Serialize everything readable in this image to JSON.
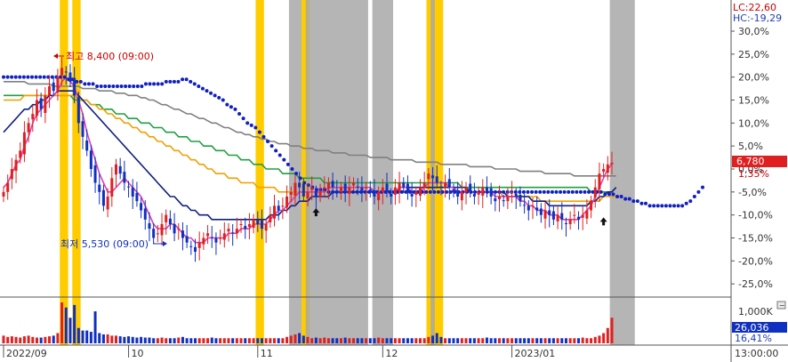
{
  "lc_label": "LC:22,60",
  "hc_label": "HC:-19,29",
  "price_tag": {
    "value": "6,780",
    "pct": "1,35%"
  },
  "high_annotation": "최고 8,400 (09:00)",
  "low_annotation": "최저 5,530 (09:00)",
  "volume_tag": {
    "value": "26,036",
    "pct": "16,41%",
    "max_label": "1,000K"
  },
  "time_label": "13:00:00",
  "x_labels": [
    {
      "label": "2022/09",
      "day": 0
    },
    {
      "label": "10",
      "day": 30
    },
    {
      "label": "11",
      "day": 61
    },
    {
      "label": "12",
      "day": 91
    },
    {
      "label": "2023/01",
      "day": 122
    }
  ],
  "colors": {
    "up": "#e02020",
    "down": "#1030c0",
    "ma5": "#e040b0",
    "ma20": "#102080",
    "ma60": "#f0a000",
    "ma120": "#20a040",
    "ma240": "#808080",
    "dots": "#1020c0",
    "yellow": "#ffcc00",
    "gray": "#a8a8a8"
  },
  "chart_data": {
    "type": "candlestick",
    "ylabel_unit": "%",
    "y_ticks": [
      "30,0%",
      "25,0%",
      "20,0%",
      "15,0%",
      "10,0%",
      "5,0%",
      "0,0%",
      "-5,0%",
      "-10,0%",
      "-15,0%",
      "-20,0%",
      "-25,0%"
    ],
    "y_tick_values": [
      30,
      25,
      20,
      15,
      10,
      5,
      0,
      -5,
      -10,
      -15,
      -20,
      -25
    ],
    "ylim": [
      -30,
      33
    ],
    "current": {
      "pct": 1.35
    },
    "high": {
      "price": 8400,
      "pct": 22.6,
      "day": 14
    },
    "low": {
      "price": 5530,
      "pct": -19.29,
      "day": 46
    },
    "highlight_bands": [
      {
        "type": "yellow",
        "start": 14,
        "end": 15
      },
      {
        "type": "yellow",
        "start": 17,
        "end": 18
      },
      {
        "type": "yellow",
        "start": 61,
        "end": 62
      },
      {
        "type": "gray",
        "start": 69,
        "end": 72
      },
      {
        "type": "yellow",
        "start": 72,
        "end": 73
      },
      {
        "type": "gray",
        "start": 73,
        "end": 87
      },
      {
        "type": "gray",
        "start": 89,
        "end": 93
      },
      {
        "type": "yellow",
        "start": 102,
        "end": 103
      },
      {
        "type": "gray",
        "start": 103,
        "end": 104
      },
      {
        "type": "yellow",
        "start": 104,
        "end": 105
      },
      {
        "type": "gray",
        "start": 146,
        "end": 151
      }
    ],
    "marker_arrows": [
      {
        "day": 75,
        "pct": -9.5
      },
      {
        "day": 144,
        "pct": -11.5
      }
    ],
    "closes": [
      -5,
      -3,
      0,
      2,
      4,
      8,
      10,
      12,
      15,
      13,
      16,
      18,
      17,
      20,
      22,
      21,
      19,
      16,
      10,
      7,
      4,
      0,
      -3,
      -5,
      -8,
      -6,
      -2,
      1,
      -1,
      -3,
      -4,
      -6,
      -7,
      -9,
      -11,
      -13,
      -15,
      -14,
      -12,
      -10,
      -12,
      -14,
      -13,
      -15,
      -16,
      -17,
      -18,
      -16,
      -15,
      -14,
      -15,
      -16,
      -15,
      -14,
      -13,
      -14,
      -13,
      -12,
      -13,
      -12,
      -11,
      -12,
      -13,
      -12,
      -10,
      -8,
      -9,
      -8,
      -6,
      -5,
      -3,
      -4,
      -6,
      -5,
      -4,
      -6,
      -5,
      -4,
      -3,
      -4,
      -5,
      -4,
      -5,
      -4,
      -3,
      -4,
      -5,
      -4,
      -5,
      -6,
      -5,
      -4,
      -5,
      -6,
      -4,
      -3,
      -4,
      -5,
      -6,
      -5,
      -4,
      -3,
      -1,
      -2,
      -3,
      -4,
      -3,
      -4,
      -5,
      -6,
      -5,
      -4,
      -5,
      -6,
      -5,
      -4,
      -5,
      -6,
      -7,
      -6,
      -7,
      -6,
      -5,
      -6,
      -7,
      -8,
      -9,
      -8,
      -9,
      -10,
      -9,
      -10,
      -11,
      -10,
      -11,
      -12,
      -11,
      -10,
      -11,
      -10,
      -9,
      -7,
      -4,
      -1,
      0,
      1,
      1.35
    ],
    "ma5": [
      -4,
      -3,
      -1,
      1,
      2,
      5,
      7,
      10,
      12,
      13,
      14,
      15,
      16,
      17,
      19,
      20,
      19,
      18,
      15,
      12,
      8,
      5,
      2,
      -1,
      -3,
      -5,
      -5,
      -4,
      -3,
      -2,
      -3,
      -4,
      -5,
      -6,
      -8,
      -10,
      -12,
      -13,
      -13,
      -13,
      -12,
      -12,
      -13,
      -14,
      -15,
      -15,
      -16,
      -16,
      -16,
      -15,
      -15,
      -15,
      -15,
      -15,
      -14,
      -14,
      -14,
      -13,
      -13,
      -13,
      -12,
      -12,
      -12,
      -12,
      -11,
      -10,
      -9,
      -9,
      -8,
      -7,
      -6,
      -5,
      -5,
      -5,
      -5,
      -5,
      -5,
      -5,
      -4,
      -4,
      -4,
      -4,
      -4,
      -4,
      -4,
      -4,
      -4,
      -4,
      -4,
      -5,
      -5,
      -5,
      -5,
      -5,
      -5,
      -4,
      -4,
      -4,
      -5,
      -5,
      -5,
      -4,
      -3,
      -3,
      -3,
      -3,
      -3,
      -4,
      -4,
      -5,
      -5,
      -5,
      -5,
      -5,
      -5,
      -5,
      -5,
      -5,
      -6,
      -6,
      -6,
      -6,
      -6,
      -6,
      -7,
      -7,
      -8,
      -8,
      -9,
      -9,
      -9,
      -10,
      -10,
      -10,
      -11,
      -11,
      -11,
      -11,
      -11,
      -10,
      -9,
      -8,
      -6,
      -4,
      -2,
      0,
      1
    ],
    "ma20": [
      8,
      9,
      10,
      11,
      12,
      13,
      13,
      14,
      14,
      15,
      15,
      16,
      16,
      17,
      17,
      17,
      17,
      17,
      16,
      15,
      14,
      13,
      12,
      11,
      10,
      9,
      8,
      7,
      6,
      5,
      4,
      3,
      2,
      1,
      0,
      -1,
      -2,
      -3,
      -4,
      -5,
      -6,
      -6,
      -7,
      -8,
      -8,
      -9,
      -9,
      -10,
      -10,
      -10,
      -11,
      -11,
      -11,
      -11,
      -11,
      -11,
      -11,
      -11,
      -11,
      -11,
      -11,
      -11,
      -11,
      -11,
      -10,
      -10,
      -10,
      -9,
      -9,
      -8,
      -8,
      -7,
      -7,
      -7,
      -6,
      -6,
      -6,
      -6,
      -6,
      -5,
      -5,
      -5,
      -5,
      -5,
      -5,
      -5,
      -5,
      -5,
      -5,
      -5,
      -5,
      -5,
      -5,
      -5,
      -5,
      -4,
      -4,
      -4,
      -4,
      -4,
      -4,
      -4,
      -4,
      -4,
      -4,
      -4,
      -4,
      -4,
      -4,
      -4,
      -4,
      -4,
      -5,
      -5,
      -5,
      -5,
      -5,
      -5,
      -5,
      -5,
      -5,
      -6,
      -6,
      -6,
      -6,
      -6,
      -6,
      -7,
      -7,
      -7,
      -7,
      -8,
      -8,
      -8,
      -8,
      -8,
      -8,
      -8,
      -8,
      -8,
      -8,
      -7,
      -7,
      -6,
      -6,
      -5,
      -5,
      -4
    ],
    "ma60": [
      15,
      15,
      15,
      15,
      15,
      16,
      16,
      16,
      16,
      16,
      16,
      16,
      16,
      16,
      16,
      16,
      16,
      16,
      15,
      15,
      15,
      14,
      14,
      13,
      13,
      12,
      12,
      11,
      11,
      10,
      10,
      9,
      9,
      8,
      8,
      7,
      7,
      6,
      6,
      5,
      5,
      4,
      4,
      3,
      3,
      2,
      2,
      1,
      1,
      0,
      0,
      -1,
      -1,
      -1,
      -2,
      -2,
      -2,
      -3,
      -3,
      -3,
      -3,
      -4,
      -4,
      -4,
      -4,
      -4,
      -5,
      -5,
      -5,
      -5,
      -5,
      -5,
      -5,
      -5,
      -5,
      -5,
      -5,
      -5,
      -5,
      -5,
      -5,
      -5,
      -5,
      -5,
      -5,
      -5,
      -5,
      -5,
      -5,
      -5,
      -5,
      -5,
      -5,
      -5,
      -5,
      -5,
      -5,
      -5,
      -5,
      -5,
      -5,
      -5,
      -5,
      -5,
      -5,
      -5,
      -5,
      -5,
      -5,
      -5,
      -5,
      -5,
      -5,
      -5,
      -5,
      -5,
      -5,
      -5,
      -5,
      -5,
      -6,
      -6,
      -6,
      -6,
      -6,
      -6,
      -6,
      -6,
      -6,
      -7,
      -7,
      -7,
      -7,
      -7,
      -7,
      -7,
      -7,
      -7,
      -7,
      -7,
      -7,
      -7,
      -7,
      -7,
      -6,
      -6,
      -6,
      -6
    ],
    "ma120": [
      16,
      16,
      16,
      16,
      16,
      16,
      16,
      16,
      16,
      16,
      16,
      16,
      16,
      16,
      16,
      16,
      16,
      15,
      15,
      15,
      15,
      14,
      14,
      14,
      13,
      13,
      13,
      12,
      12,
      12,
      11,
      11,
      11,
      10,
      10,
      10,
      9,
      9,
      9,
      8,
      8,
      8,
      7,
      7,
      7,
      6,
      6,
      6,
      5,
      5,
      5,
      4,
      4,
      4,
      3,
      3,
      3,
      2,
      2,
      2,
      1,
      1,
      1,
      0,
      0,
      0,
      0,
      -1,
      -1,
      -1,
      -1,
      -2,
      -2,
      -2,
      -2,
      -2,
      -2,
      -3,
      -3,
      -3,
      -3,
      -3,
      -3,
      -3,
      -3,
      -3,
      -3,
      -3,
      -3,
      -3,
      -3,
      -3,
      -3,
      -3,
      -3,
      -3,
      -3,
      -3,
      -3,
      -3,
      -3,
      -3,
      -3,
      -3,
      -3,
      -3,
      -3,
      -3,
      -3,
      -3,
      -4,
      -4,
      -4,
      -4,
      -4,
      -4,
      -4,
      -4,
      -4,
      -4,
      -4,
      -4,
      -4,
      -4,
      -4,
      -4,
      -4,
      -4,
      -4,
      -4,
      -4,
      -4,
      -4,
      -4,
      -4,
      -4,
      -4,
      -4,
      -4,
      -4,
      -4,
      -5,
      -5,
      -5,
      -5,
      -5
    ],
    "ma240": [
      19,
      19,
      19,
      19,
      19,
      19,
      18.5,
      18.5,
      18.5,
      18.5,
      18.5,
      18.5,
      18,
      18,
      18,
      18,
      18,
      18,
      18,
      17.5,
      17.5,
      17.5,
      17.5,
      17,
      17,
      17,
      17,
      16.5,
      16.5,
      16.5,
      16,
      16,
      16,
      15.5,
      15.5,
      15,
      15,
      14.5,
      14,
      14,
      13.5,
      13,
      13,
      12.5,
      12,
      12,
      11.5,
      11,
      11,
      10.5,
      10,
      10,
      9.5,
      9,
      9,
      8.5,
      8,
      8,
      7.5,
      7.5,
      7,
      7,
      6.5,
      6.5,
      6,
      6,
      5.5,
      5.5,
      5.5,
      5,
      5,
      5,
      4.5,
      4.5,
      4.5,
      4,
      4,
      4,
      4,
      3.5,
      3.5,
      3.5,
      3.5,
      3,
      3,
      3,
      3,
      3,
      2.5,
      2.5,
      2.5,
      2.5,
      2.5,
      2,
      2,
      2,
      2,
      2,
      2,
      1.5,
      1.5,
      1.5,
      1.5,
      1.5,
      1.5,
      1,
      1,
      1,
      1,
      1,
      1,
      1,
      0.5,
      0.5,
      0.5,
      0.5,
      0.5,
      0.5,
      0,
      0,
      0,
      0,
      0,
      0,
      -0.5,
      -0.5,
      -0.5,
      -0.5,
      -0.5,
      -0.5,
      -1,
      -1,
      -1,
      -1,
      -1,
      -1,
      -1,
      -1.5,
      -1.5,
      -1.5,
      -1.5,
      -1.5,
      -1.5,
      -1.5,
      -1.5,
      -1.5,
      -1.5,
      -1.5
    ],
    "dots": [
      20,
      20,
      20,
      20,
      20,
      20,
      20,
      20,
      20,
      20,
      20,
      20,
      20,
      20,
      20,
      20,
      19.5,
      19.5,
      19,
      19,
      18.5,
      18.5,
      18.5,
      18,
      18,
      18,
      18,
      18,
      18,
      18,
      18,
      18,
      18,
      18,
      18,
      18.5,
      18.5,
      18.5,
      18.5,
      18.5,
      19,
      19,
      19,
      19,
      19.5,
      19.5,
      19,
      18.5,
      18,
      17.5,
      17,
      16.5,
      16,
      15.5,
      15,
      14,
      13.5,
      13,
      12,
      11,
      10,
      9.5,
      9,
      8,
      7,
      6,
      5,
      4,
      3,
      2,
      1,
      0,
      -1,
      -2,
      -3,
      -3.5,
      -4,
      -4.5,
      -4.5,
      -4.5,
      -5,
      -5,
      -5,
      -5,
      -5,
      -5,
      -5,
      -5,
      -5,
      -5,
      -5,
      -5,
      -5,
      -5,
      -5,
      -5,
      -5,
      -5,
      -5,
      -5,
      -5,
      -5,
      -5,
      -5,
      -5,
      -5,
      -5,
      -5,
      -5,
      -5,
      -5,
      -5,
      -5,
      -5,
      -5,
      -5,
      -5,
      -5,
      -5,
      -5,
      -5,
      -5,
      -5,
      -5,
      -5,
      -5,
      -5,
      -5,
      -5,
      -5,
      -5,
      -5,
      -5,
      -5,
      -5,
      -5,
      -5,
      -5,
      -5,
      -5,
      -5,
      -5,
      -5,
      -5,
      -5,
      -5,
      -5,
      -5,
      -5.5,
      -5.5,
      -5.5,
      -6,
      -6,
      -6.5,
      -6.5,
      -7,
      -7,
      -7.5,
      -7.5,
      -8,
      -8,
      -8,
      -8,
      -8,
      -8,
      -8,
      -8,
      -8,
      -7.5,
      -7,
      -6,
      -5,
      -4
    ],
    "volumes": [
      60,
      50,
      55,
      50,
      45,
      55,
      60,
      50,
      45,
      45,
      50,
      55,
      60,
      80,
      320,
      280,
      200,
      300,
      120,
      100,
      100,
      90,
      250,
      80,
      70,
      70,
      60,
      60,
      55,
      50,
      55,
      50,
      45,
      50,
      45,
      45,
      40,
      40,
      45,
      40,
      40,
      40,
      45,
      50,
      40,
      40,
      40,
      40,
      40,
      40,
      45,
      40,
      40,
      40,
      40,
      40,
      40,
      40,
      40,
      40,
      40,
      40,
      40,
      40,
      40,
      40,
      40,
      40,
      50,
      60,
      70,
      80,
      60,
      50,
      40,
      45,
      40,
      45,
      40,
      40,
      40,
      40,
      45,
      40,
      40,
      40,
      40,
      40,
      40,
      40,
      45,
      40,
      40,
      40,
      40,
      40,
      40,
      40,
      40,
      40,
      40,
      40,
      50,
      60,
      80,
      50,
      40,
      40,
      40,
      40,
      40,
      40,
      40,
      40,
      40,
      40,
      45,
      40,
      40,
      40,
      40,
      40,
      40,
      40,
      40,
      40,
      40,
      40,
      40,
      40,
      40,
      40,
      40,
      40,
      40,
      40,
      40,
      40,
      40,
      45,
      40,
      40,
      50,
      60,
      80,
      120,
      200,
      150,
      100,
      80,
      60
    ]
  }
}
